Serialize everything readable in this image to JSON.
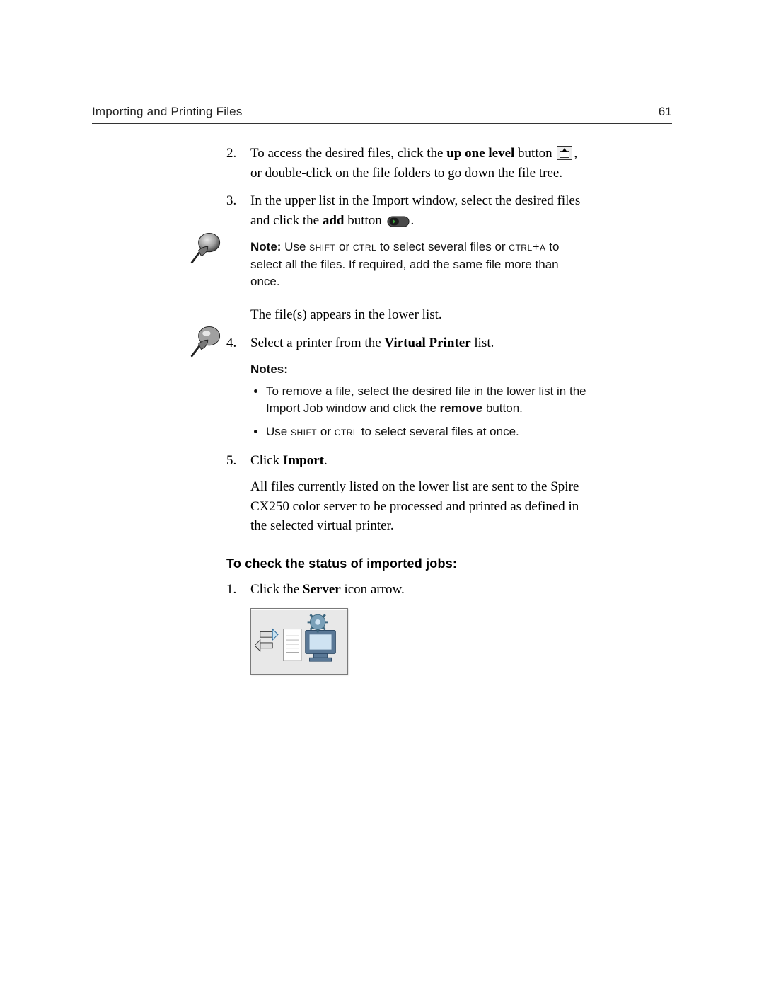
{
  "header": {
    "title": "Importing and Printing Files",
    "page_number": "61"
  },
  "step2": {
    "num": "2.",
    "t1": "To access the desired files, click the ",
    "b1": "up one level",
    "t2": " button ",
    "t3": ", or double-click on the file folders to go down the file tree."
  },
  "step3": {
    "num": "3.",
    "t1": "In the upper list in the Import window, select the desired files and click the ",
    "b1": "add",
    "t2": " button ",
    "t3": "."
  },
  "note1": {
    "label": "Note:",
    "t1": "  Use ",
    "k1": "shift",
    "t2": " or ",
    "k2": "ctrl",
    "t3": " to select several files or ",
    "k3": "ctrl+a",
    "t4": " to select all the files. If required, add the same file more than once."
  },
  "line_after_note": "The file(s) appears in the lower list.",
  "step4": {
    "num": "4.",
    "t1": "Select a printer from the ",
    "b1": "Virtual Printer",
    "t2": " list."
  },
  "note2": {
    "label": "Notes:",
    "b1_t1": "To remove a file, select the desired file in the lower list in the Import Job window and click the ",
    "b1_bold": "remove",
    "b1_t2": " button.",
    "b2_t1": "Use ",
    "b2_k1": "shift",
    "b2_t2": " or ",
    "b2_k2": "ctrl",
    "b2_t3": " to select several files at once."
  },
  "step5": {
    "num": "5.",
    "t1": "Click ",
    "b1": "Import",
    "t2": ".",
    "p2": "All files currently listed on the lower list are sent to the Spire CX250 color server to be processed and printed as defined in the selected virtual printer."
  },
  "heading2": "To check the status of imported jobs:",
  "stepS1": {
    "num": "1.",
    "t1": "Click the ",
    "b1": "Server",
    "t2": " icon arrow."
  }
}
